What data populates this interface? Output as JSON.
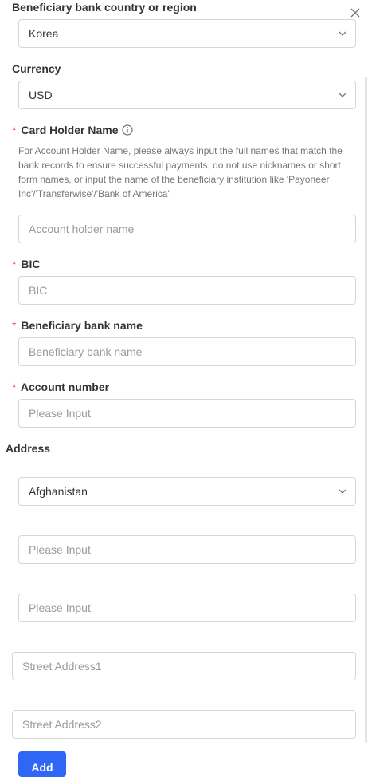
{
  "close_icon": "close-icon",
  "beneficiary_country": {
    "label": "Beneficiary bank country or region",
    "value": "Korea"
  },
  "currency": {
    "label": "Currency",
    "value": "USD"
  },
  "card_holder": {
    "required_mark": "*",
    "label": "Card Holder Name",
    "help_text": "For Account Holder Name, please always input the full names that match the bank records to ensure successful payments, do not use nicknames or short form names, or input the name of the beneficiary institution like 'Payoneer Inc'/'Transferwise'/'Bank of America'",
    "placeholder": "Account holder name"
  },
  "bic": {
    "required_mark": "*",
    "label": "BIC",
    "placeholder": "BIC"
  },
  "bank_name": {
    "required_mark": "*",
    "label": "Beneficiary bank name",
    "placeholder": "Beneficiary bank name"
  },
  "account_number": {
    "required_mark": "*",
    "label": "Account number",
    "placeholder": "Please Input"
  },
  "address": {
    "label": "Address",
    "country_value": "Afghanistan",
    "input1_placeholder": "Please Input",
    "input2_placeholder": "Please Input",
    "street1_placeholder": "Street Address1",
    "street2_placeholder": "Street Address2"
  },
  "add_button_label": "Add",
  "colors": {
    "accent": "#2f66f5",
    "required": "#e5484d",
    "border": "#d6d6d6"
  }
}
